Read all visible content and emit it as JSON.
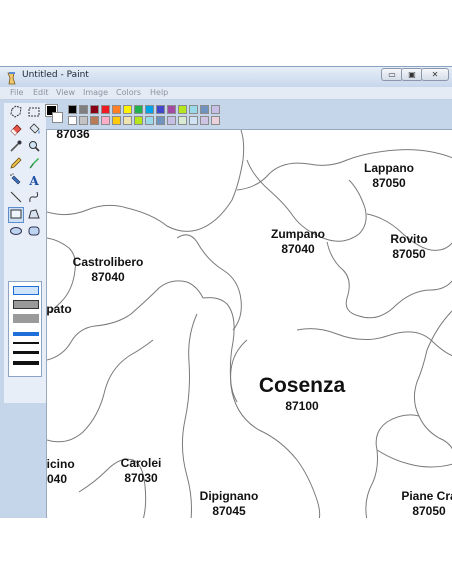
{
  "window": {
    "title": "Untitled - Paint",
    "buttons": {
      "minimize": "▭",
      "maximize": "▣",
      "close": "✕"
    }
  },
  "menu": [
    "File",
    "Edit",
    "View",
    "Image",
    "Colors",
    "Help"
  ],
  "tools": [
    {
      "name": "free-form-select-icon",
      "selected": false
    },
    {
      "name": "rect-select-icon",
      "selected": false
    },
    {
      "name": "eraser-icon",
      "selected": false
    },
    {
      "name": "fill-bucket-icon",
      "selected": false
    },
    {
      "name": "color-picker-icon",
      "selected": false
    },
    {
      "name": "magnifier-icon",
      "selected": false
    },
    {
      "name": "pencil-icon",
      "selected": false
    },
    {
      "name": "brush-icon",
      "selected": false
    },
    {
      "name": "airbrush-icon",
      "selected": false
    },
    {
      "name": "text-icon",
      "selected": false
    },
    {
      "name": "line-icon",
      "selected": false
    },
    {
      "name": "curve-icon",
      "selected": false
    },
    {
      "name": "rectangle-icon",
      "selected": true
    },
    {
      "name": "polygon-icon",
      "selected": false
    },
    {
      "name": "ellipse-icon",
      "selected": false
    },
    {
      "name": "rounded-rect-icon",
      "selected": false
    }
  ],
  "colors": {
    "foreground": "#000000",
    "background": "#ffffff",
    "palette_top": [
      "#000000",
      "#7f7f7f",
      "#880015",
      "#ed1c24",
      "#ff7f27",
      "#fff200",
      "#22b14c",
      "#00a2e8",
      "#3f48cc",
      "#a349a4",
      "#b5e61d",
      "#99d9ea",
      "#7092be",
      "#c8bfe7"
    ],
    "palette_bottom": [
      "#ffffff",
      "#c3c3c3",
      "#b97a57",
      "#ffaec9",
      "#ffc90e",
      "#efe4b0",
      "#b5e61d",
      "#99d9ea",
      "#7092be",
      "#c8bfe7",
      "#d9ead3",
      "#cfe2f3",
      "#d0c4e4",
      "#ead1dc"
    ]
  },
  "map": {
    "labels": [
      {
        "id": "cap-top",
        "name": "87036"
      },
      {
        "id": "lappano",
        "name": "Lappano",
        "cap": "87050"
      },
      {
        "id": "zumpano",
        "name": "Zumpano",
        "cap": "87040"
      },
      {
        "id": "rovito",
        "name": "Rovito",
        "cap": "87050"
      },
      {
        "id": "castrolibero",
        "name": "Castrolibero",
        "cap": "87040"
      },
      {
        "id": "pato",
        "name": "pato"
      },
      {
        "id": "cosenza",
        "name": "Cosenza",
        "cap": "87100"
      },
      {
        "id": "dicino",
        "name": "dicino",
        "cap": "040"
      },
      {
        "id": "carolei",
        "name": "Carolei",
        "cap": "87030"
      },
      {
        "id": "dipignano",
        "name": "Dipignano",
        "cap": "87045"
      },
      {
        "id": "piane-crati",
        "name": "Piane Cra",
        "cap": "87050"
      }
    ]
  }
}
